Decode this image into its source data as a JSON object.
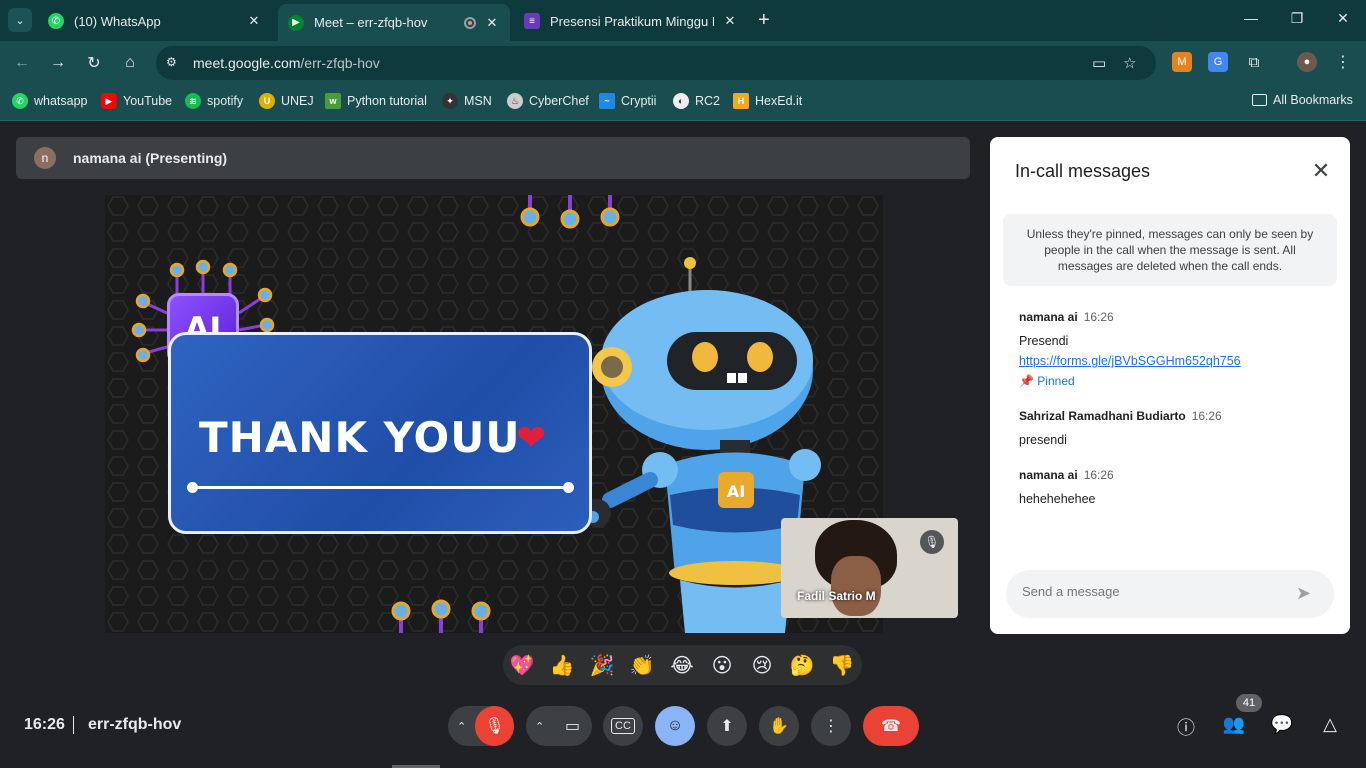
{
  "browser": {
    "tabs": [
      {
        "title": "(10) WhatsApp",
        "favicon": "whatsapp-icon"
      },
      {
        "title": "Meet – err-zfqb-hov",
        "favicon": "meet-icon"
      },
      {
        "title": "Presensi Praktikum Minggu Ke-",
        "favicon": "forms-icon"
      }
    ],
    "url_domain": "meet.google.com",
    "url_path": "/err-zfqb-hov",
    "bookmarks": [
      "whatsapp",
      "YouTube",
      "spotify",
      "UNEJ",
      "Python tutorial",
      "MSN",
      "CyberChef",
      "Cryptii",
      "RC2",
      "HexEd.it"
    ],
    "all_bookmarks": "All Bookmarks"
  },
  "meet": {
    "presenter_initial": "n",
    "presenter_label": "namana ai (Presenting)",
    "slide_text": "THANK YOUU",
    "slide_chip": "AI",
    "self_name": "Fadil Satrio M",
    "time": "16:26",
    "meeting_code": "err-zfqb-hov",
    "participants_count": "41",
    "reactions": [
      "💖",
      "👍",
      "🎉",
      "👏",
      "😂",
      "😮",
      "😢",
      "🤔",
      "👎"
    ]
  },
  "chat": {
    "title": "In-call messages",
    "notice": "Unless they're pinned, messages can only be seen by people in the call when the message is sent. All messages are deleted when the call ends.",
    "messages": [
      {
        "sender": "namana ai",
        "time": "16:26",
        "body": "Presendi",
        "link": "https://forms.gle/jBVbSGGHm652qh756",
        "pinned": "Pinned"
      },
      {
        "sender": "Sahrizal Ramadhani Budiarto",
        "time": "16:26",
        "body": "presendi"
      },
      {
        "sender": "namana ai",
        "time": "16:26",
        "body": "hehehehehee"
      }
    ],
    "input_placeholder": "Send a message"
  },
  "colors": {
    "browser_frame": "#0e3a3d",
    "browser_toolbar": "#1a4d50",
    "meet_bg": "#202124",
    "end_call": "#ea4335",
    "active_control": "#8ab4f8",
    "link": "#1a73e8"
  }
}
